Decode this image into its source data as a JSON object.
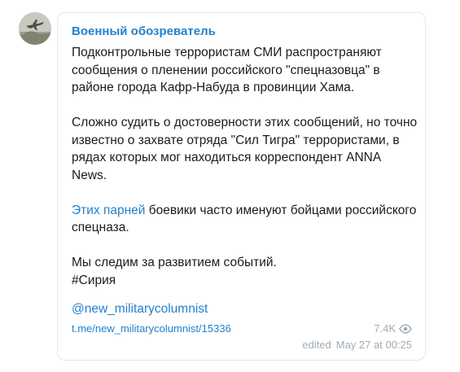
{
  "post": {
    "channel_name": "Военный обозреватель",
    "avatar_icon": "channel-avatar-aircraft",
    "paragraph1": "Подконтрольные террористам СМИ распространяют сообщения о пленении российского \"спецназовца\" в районе города Кафр-Набуда в провинции Хама.",
    "paragraph2": "Сложно судить о достоверности этих сообщений, но точно известно о захвате отряда \"Сил Тигра\" террористами, в рядах которых мог находиться корреспондент ANNA News.",
    "paragraph3_link": "Этих парней",
    "paragraph3_rest": " боевики часто именуют бойцами российского спецназа.",
    "paragraph4": "Мы следим за развитием событий.",
    "hashtag": "#Сирия",
    "mention": "@new_militarycolumnist",
    "post_link": "t.me/new_militarycolumnist/15336",
    "views": "7.4K",
    "views_icon": "eye-icon",
    "edited_label": "edited",
    "date": "May 27 at 00:25"
  },
  "colors": {
    "accent": "#2481cc",
    "text": "#1b1b1b",
    "muted": "#a0acb6",
    "border": "#e4e7ea"
  }
}
